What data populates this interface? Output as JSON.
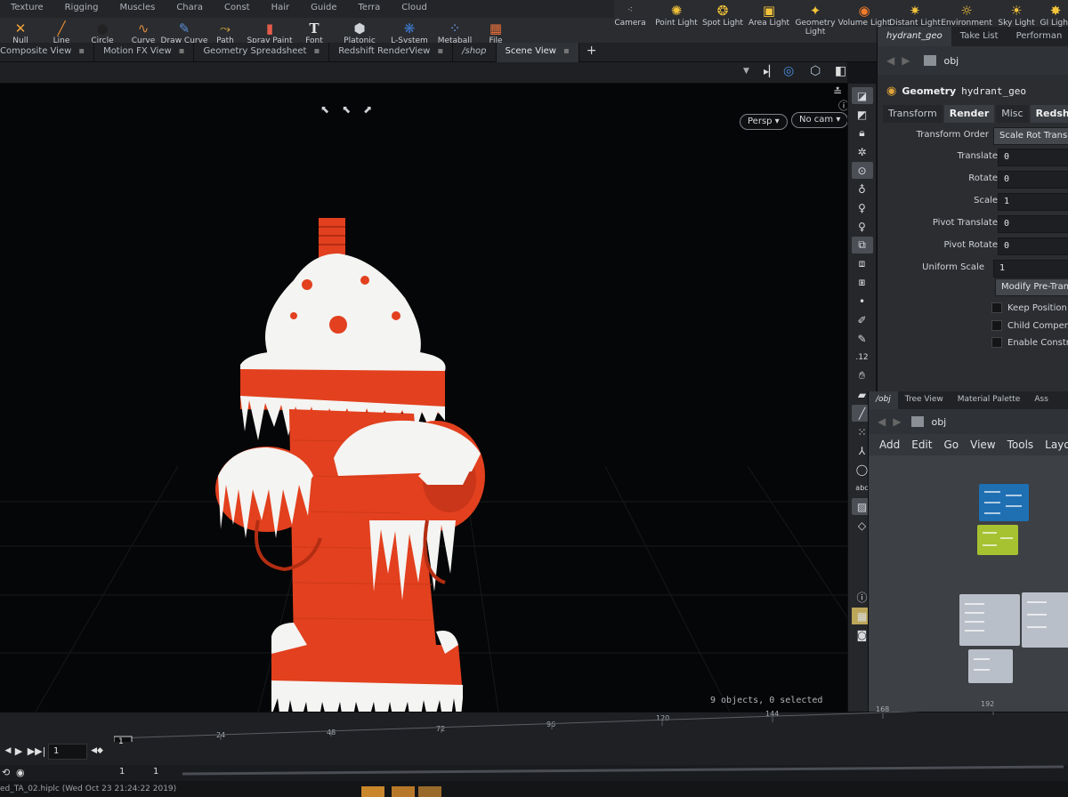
{
  "shelf": {
    "tabs": [
      "Texture",
      "Rigging",
      "Muscles",
      "Chara",
      "Const",
      "Hair",
      "Guide",
      "Terra",
      "Cloud"
    ],
    "tools": [
      {
        "label": "Null",
        "icon": "null-icon"
      },
      {
        "label": "Line",
        "icon": "line-icon"
      },
      {
        "label": "Circle",
        "icon": "circle-icon"
      },
      {
        "label": "Curve",
        "icon": "curve-icon"
      },
      {
        "label": "Draw Curve",
        "icon": "draw-curve-icon"
      },
      {
        "label": "Path",
        "icon": "path-icon"
      },
      {
        "label": "Spray Paint",
        "icon": "spray-paint-icon"
      },
      {
        "label": "Font",
        "icon": "font-icon"
      },
      {
        "label": "Platonic Solids",
        "icon": "platonic-solids-icon"
      },
      {
        "label": "L-System",
        "icon": "l-system-icon"
      },
      {
        "label": "Metaball",
        "icon": "metaball-icon"
      },
      {
        "label": "File",
        "icon": "file-icon"
      }
    ],
    "lights": [
      {
        "label": "Camera",
        "icon": "camera-icon"
      },
      {
        "label": "Point Light",
        "icon": "point-light-icon"
      },
      {
        "label": "Spot Light",
        "icon": "spot-light-icon"
      },
      {
        "label": "Area Light",
        "icon": "area-light-icon"
      },
      {
        "label": "Geometry Light",
        "icon": "geometry-light-icon"
      },
      {
        "label": "Volume Light",
        "icon": "volume-light-icon"
      },
      {
        "label": "Distant Light",
        "icon": "distant-light-icon"
      },
      {
        "label": "Environment Light",
        "icon": "environment-light-icon"
      },
      {
        "label": "Sky Light",
        "icon": "sky-light-icon"
      },
      {
        "label": "GI Light",
        "icon": "gi-light-icon"
      }
    ]
  },
  "pane_tabs": [
    {
      "label": "Composite View",
      "active": false
    },
    {
      "label": "Motion FX View",
      "active": false
    },
    {
      "label": "Geometry Spreadsheet",
      "active": false
    },
    {
      "label": "Redshift RenderView",
      "active": false
    },
    {
      "label": "/shop",
      "active": false
    },
    {
      "label": "Scene View",
      "active": true
    }
  ],
  "add_tab": "+",
  "viewport": {
    "persp": "Persp ▾",
    "cam": "No cam ▾",
    "status": "9 objects, 0 selected"
  },
  "right_pane": {
    "tabs": [
      {
        "label": "hydrant_geo",
        "active": true
      },
      {
        "label": "Take List",
        "active": false
      },
      {
        "label": "Performan",
        "active": false
      }
    ],
    "path": "obj",
    "node_type": "Geometry",
    "node_name": "hydrant_geo",
    "param_tabs": [
      {
        "label": "Transform",
        "active": false
      },
      {
        "label": "Render",
        "active": true
      },
      {
        "label": "Misc",
        "active": false
      },
      {
        "label": "Redshift OB",
        "active": false
      }
    ],
    "params": [
      {
        "label": "Transform Order",
        "value": "Scale Rot Trans",
        "kind": "button"
      },
      {
        "label": "Translate",
        "value": "0",
        "kind": "field"
      },
      {
        "label": "Rotate",
        "value": "0",
        "kind": "field"
      },
      {
        "label": "Scale",
        "value": "1",
        "kind": "field"
      },
      {
        "label": "Pivot Translate",
        "value": "0",
        "kind": "field"
      },
      {
        "label": "Pivot Rotate",
        "value": "0",
        "kind": "field"
      },
      {
        "label": "Uniform Scale",
        "value": "1",
        "kind": "field"
      }
    ],
    "modify_button": "Modify Pre-Transform",
    "checks": [
      "Keep Position When Parenting",
      "Child Compensation",
      "Enable Constraints"
    ]
  },
  "network": {
    "tabs": [
      {
        "label": "/obj",
        "active": true
      },
      {
        "label": "Tree View",
        "active": false
      },
      {
        "label": "Material Palette",
        "active": false
      },
      {
        "label": "Ass",
        "active": false
      }
    ],
    "path": "obj",
    "menu": [
      "Add",
      "Edit",
      "Go",
      "View",
      "Tools",
      "Layout"
    ]
  },
  "timeline": {
    "frame": "1",
    "ticks": [
      "24",
      "48",
      "72",
      "96",
      "120",
      "144",
      "168",
      "192"
    ],
    "current": "1",
    "range_start": "1",
    "range_end": "1",
    "file_status": "ed_TA_02.hiplc (Wed Oct 23 21:24:22 2019)"
  },
  "colors": {
    "hydrant_red": "#e2401e",
    "snow": "#f4f4f2",
    "node_blue": "#1f6fb3",
    "node_green": "#a6c231",
    "node_grey": "#b9bfc8"
  }
}
